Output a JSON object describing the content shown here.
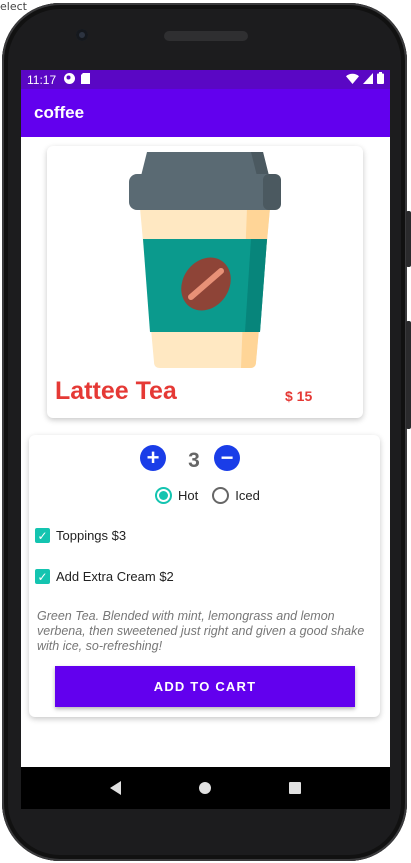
{
  "window_corner_text": "elect",
  "status_bar": {
    "time": "11:17",
    "icons": [
      "notification-app-icon",
      "sd-card-icon",
      "wifi-icon",
      "signal-icon",
      "battery-icon"
    ]
  },
  "app_bar": {
    "title": "coffee"
  },
  "product": {
    "name": "Lattee Tea",
    "price": "$ 15",
    "image": "coffee-cup-icon"
  },
  "quantity": {
    "value": "3",
    "increment_label": "+",
    "decrement_label": "−"
  },
  "temperature": {
    "options": [
      "Hot",
      "Iced"
    ],
    "selected": "Hot"
  },
  "extras": [
    {
      "label": "Toppings $3",
      "checked": true
    },
    {
      "label": "Add Extra Cream $2",
      "checked": true
    }
  ],
  "description": "Green Tea. Blended with mint, lemongrass and lemon verbena, then sweetened just right and given a good shake with ice, so-refreshing!",
  "add_to_cart_label": "ADD TO CART",
  "colors": {
    "status_bar": "#5a07c4",
    "app_bar": "#6200ee",
    "price_red": "#e53935",
    "accent_teal": "#14c4b0",
    "button_blue": "#1a3de8"
  }
}
